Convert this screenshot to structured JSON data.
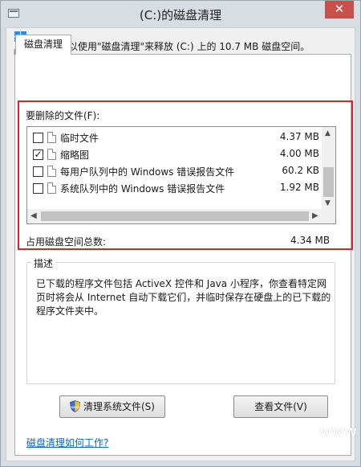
{
  "window": {
    "title": "(C:)的磁盘清理",
    "close_label": "✕"
  },
  "tabs": [
    {
      "label": "磁盘清理"
    }
  ],
  "summary_text": "可以使用\"磁盘清理\"来释放  (C:) 上的 10.7 MB 磁盘空间。",
  "files_to_delete": {
    "label": "要删除的文件(F):",
    "items": [
      {
        "name": "临时文件",
        "size": "4.37 MB",
        "checked": false
      },
      {
        "name": "缩略图",
        "size": "4.00 MB",
        "checked": true
      },
      {
        "name": "每用户队列中的 Windows 错误报告文件",
        "size": "60.2 KB",
        "checked": false
      },
      {
        "name": "系统队列中的 Windows 错误报告文件",
        "size": "1.92 MB",
        "checked": false
      }
    ]
  },
  "total": {
    "label": "占用磁盘空间总数:",
    "value": "4.34 MB"
  },
  "description": {
    "title": "描述",
    "text": "已下载的程序文件包括 ActiveX 控件和 Java 小程序，你查看特定网页时将会从 Internet 自动下载它们，并临时保存在硬盘上的已下载的程序文件夹中。"
  },
  "buttons": {
    "clean_system": "清理系统文件(S)",
    "view_files": "查看文件(V)"
  },
  "help_link": "磁盘清理如何工作?",
  "watermark": "www"
}
